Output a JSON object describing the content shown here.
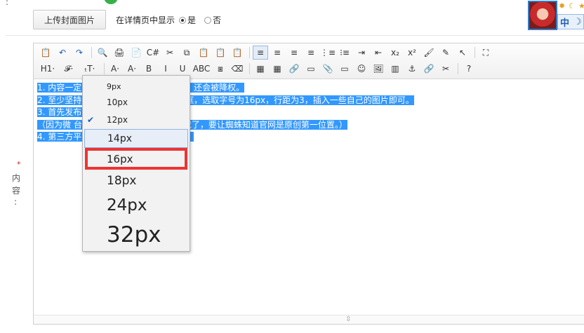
{
  "top": {
    "colons": [
      ":",
      ":"
    ],
    "upload_button": "上传封面图片",
    "display_label": "在详情页中显示",
    "radio_yes": "是",
    "radio_no": "否",
    "lang_label": "中",
    "moon": "☽",
    "sun_icons": [
      "✹",
      "☾",
      "★"
    ]
  },
  "side": {
    "required": "*",
    "label_chars": [
      "内",
      "容",
      ":"
    ]
  },
  "toolbar": {
    "row1": [
      "📋",
      "↶",
      "↷",
      "|",
      "🔍",
      "🖨",
      "📄",
      "C#",
      "✂",
      "⧉",
      "📋",
      "📋",
      "📋",
      "|",
      "≡",
      "≡",
      "≡",
      "≡",
      "⋮≡",
      "⁝≡",
      "⇥",
      "⇤",
      "x₂",
      "x²",
      "🖌",
      "✎",
      "↖",
      "|",
      "⛶"
    ],
    "row2": [
      "H1·",
      "𝓕·",
      "ₜT·",
      "|",
      "A·",
      "A·",
      "B",
      "I",
      "U",
      "ABC",
      "⧆",
      "⌫",
      "|",
      "▦",
      "▦",
      "🔗",
      "▭",
      "📎",
      "▭",
      "☺",
      "🖼",
      "▥",
      "⚓",
      "🔗",
      "✂",
      "|",
      "?"
    ]
  },
  "content": {
    "lines": [
      "1. 内容一定                                                              度不会收录，没有任何意义，还会被降权。",
      "2. 至少坚持                                                              本里打好，然后复制到发布框，选取字号为16px，行距为3，插入一些自己的图片即可。",
      "3. 首先发布                                                              后再发布其他媒体平台。",
      "    （因为微                                                              台权重高收录快，否则就成转载了，要让蜘蛛知道官网是原创第一位置。）",
      "4. 第三方平                                                              本身内容的链接，实现引流。"
    ]
  },
  "font_size_dropdown": {
    "options": [
      "9px",
      "10px",
      "12px",
      "14px",
      "16px",
      "18px",
      "24px",
      "32px"
    ],
    "selected": "12px",
    "hovered": "14px",
    "highlighted": "16px",
    "check": "✔"
  },
  "grip": "⇳"
}
